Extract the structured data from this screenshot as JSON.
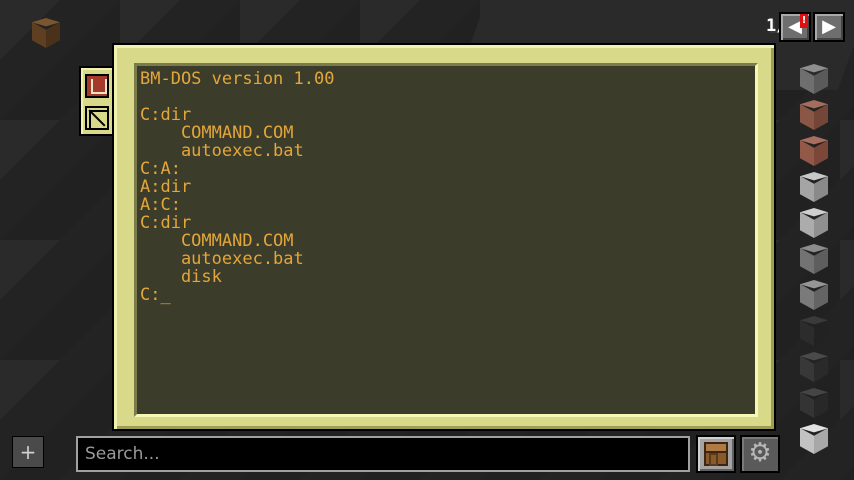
{
  "hud": {
    "page_counter": "1/3",
    "prev_arrow": "◀",
    "next_arrow": "▶",
    "alert": "!"
  },
  "terminal": {
    "lines": [
      "BM-DOS version 1.00",
      "",
      "C:dir",
      "    COMMAND.COM",
      "    autoexec.bat",
      "C:A:",
      "A:dir",
      "A:C:",
      "C:dir",
      "    COMMAND.COM",
      "    autoexec.bat",
      "    disk",
      "C:_"
    ],
    "text_color": "#e3a63a",
    "screen_color": "#3c3c2b",
    "frame_color": "#d9d98a"
  },
  "side_tabs": [
    {
      "icon": "eject-icon"
    },
    {
      "icon": "disable-icon"
    }
  ],
  "item_column": [
    {
      "icon": "stone-block-icon",
      "top": "#8e8e8e",
      "left": "#6f6f6f",
      "right": "#5a5a5a"
    },
    {
      "icon": "granite-block-icon",
      "top": "#a26e5e",
      "left": "#8a5646",
      "right": "#744638"
    },
    {
      "icon": "polished-granite-block-icon",
      "top": "#a86f5f",
      "left": "#925848",
      "right": "#7a4739"
    },
    {
      "icon": "diorite-block-icon",
      "top": "#c8c8c8",
      "left": "#a5a5a5",
      "right": "#8a8a8a"
    },
    {
      "icon": "polished-diorite-block-icon",
      "top": "#cfcfcf",
      "left": "#acacac",
      "right": "#909090"
    },
    {
      "icon": "andesite-block-icon",
      "top": "#8c8c8c",
      "left": "#737373",
      "right": "#5e5e5e"
    },
    {
      "icon": "polished-andesite-block-icon",
      "top": "#959595",
      "left": "#7a7a7a",
      "right": "#646464"
    },
    {
      "icon": "blackstone-block-icon",
      "top": "#3a3a3a",
      "left": "#2c2c2c",
      "right": "#222222"
    },
    {
      "icon": "basalt-block-icon",
      "top": "#4a4a4a",
      "left": "#383838",
      "right": "#2a2a2a"
    },
    {
      "icon": "deepslate-block-icon",
      "top": "#454545",
      "left": "#343434",
      "right": "#282828"
    },
    {
      "icon": "calcite-block-icon",
      "top": "#e2e2e2",
      "left": "#c2c2c2",
      "right": "#a8a8a8"
    }
  ],
  "held_block": {
    "icon": "oak-log-block-icon",
    "top": "#7a5532",
    "left": "#5e3f22",
    "right": "#4a3119"
  },
  "bottom_bar": {
    "add_label": "+",
    "search_placeholder": "Search...",
    "crafting_icon": "crafting-table-icon",
    "settings_label": "⚙"
  }
}
